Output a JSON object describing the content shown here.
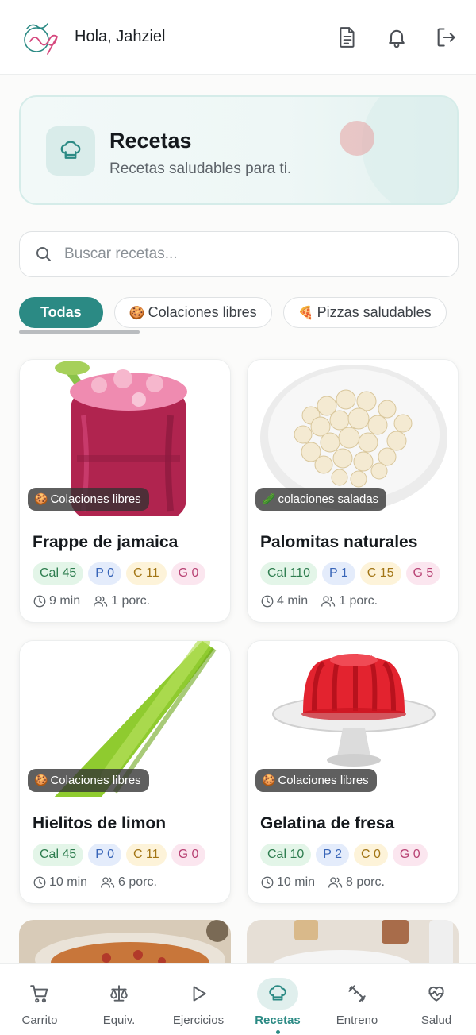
{
  "header": {
    "greeting": "Hola, Jahziel",
    "icons": [
      "document-icon",
      "bell-icon",
      "logout-icon"
    ]
  },
  "hero": {
    "title": "Recetas",
    "subtitle": "Recetas saludables para ti.",
    "icon": "chef-hat-icon"
  },
  "search": {
    "placeholder": "Buscar recetas...",
    "value": ""
  },
  "filters": [
    {
      "label": "Todas",
      "emoji": "",
      "active": true
    },
    {
      "label": "Colaciones libres",
      "emoji": "🍪",
      "active": false
    },
    {
      "label": "Pizzas saludables",
      "emoji": "🍕",
      "active": false
    }
  ],
  "recipes": [
    {
      "title": "Frappe de jamaica",
      "category": "Colaciones libres",
      "category_emoji": "🍪",
      "cal": "Cal 45",
      "p": "P 0",
      "c": "C 11",
      "g": "G 0",
      "time": "9 min",
      "portions": "1 porc."
    },
    {
      "title": "Palomitas naturales",
      "category": "colaciones saladas",
      "category_emoji": "🥒",
      "cal": "Cal 110",
      "p": "P 1",
      "c": "C 15",
      "g": "G 5",
      "time": "4 min",
      "portions": "1 porc."
    },
    {
      "title": "Hielitos de limon",
      "category": "Colaciones libres",
      "category_emoji": "🍪",
      "cal": "Cal 45",
      "p": "P 0",
      "c": "C 11",
      "g": "G 0",
      "time": "10 min",
      "portions": "6 porc."
    },
    {
      "title": "Gelatina de fresa",
      "category": "Colaciones libres",
      "category_emoji": "🍪",
      "cal": "Cal 10",
      "p": "P 2",
      "c": "C 0",
      "g": "G 0",
      "time": "10 min",
      "portions": "8 porc."
    }
  ],
  "nav": [
    {
      "label": "Carrito",
      "icon": "cart-icon",
      "active": false
    },
    {
      "label": "Equiv.",
      "icon": "scale-icon",
      "active": false
    },
    {
      "label": "Ejercicios",
      "icon": "play-icon",
      "active": false
    },
    {
      "label": "Recetas",
      "icon": "chef-hat-icon",
      "active": true
    },
    {
      "label": "Entreno",
      "icon": "dumbbell-icon",
      "active": false
    },
    {
      "label": "Salud",
      "icon": "heart-pulse-icon",
      "active": false
    }
  ],
  "colors": {
    "accent": "#2b8a84",
    "accent_soft": "#e0efed"
  }
}
